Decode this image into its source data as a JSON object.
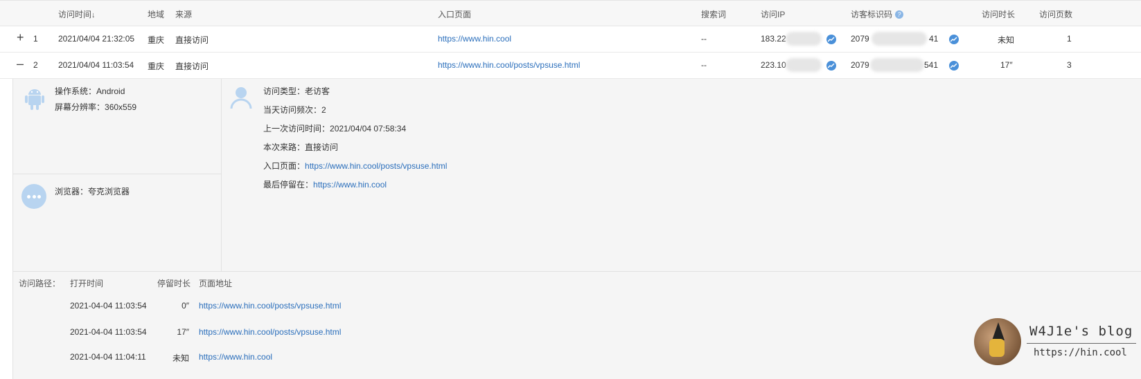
{
  "table": {
    "headers": {
      "visit_time": "访问时间",
      "sort_arrow": "↓",
      "region": "地域",
      "source": "来源",
      "entry_page": "入口页面",
      "search_term": "搜索词",
      "visit_ip": "访问IP",
      "visitor_id": "访客标识码",
      "help": "?",
      "duration": "访问时长",
      "pages": "访问页数"
    },
    "rows": [
      {
        "expander": "+",
        "index": "1",
        "time": "2021/04/04 21:32:05",
        "region": "重庆",
        "source": "直接访问",
        "entry_page": "https://www.hin.cool",
        "search_term": "--",
        "ip_prefix": "183.22",
        "visitor_prefix": "2079",
        "visitor_suffix": "41",
        "duration": "未知",
        "pages": "1"
      },
      {
        "expander": "–",
        "index": "2",
        "time": "2021/04/04 11:03:54",
        "region": "重庆",
        "source": "直接访问",
        "entry_page": "https://www.hin.cool/posts/vpsuse.html",
        "search_term": "--",
        "ip_prefix": "223.10",
        "visitor_prefix": "2079",
        "visitor_suffix": "541",
        "duration": "17″",
        "pages": "3"
      }
    ]
  },
  "detail": {
    "os_label": "操作系统：",
    "os_value": "Android",
    "resolution_label": "屏幕分辨率：",
    "resolution_value": "360x559",
    "browser_label": "浏览器：",
    "browser_value": "夸克浏览器",
    "visit_type_label": "访问类型：",
    "visit_type_value": "老访客",
    "daily_freq_label": "当天访问频次：",
    "daily_freq_value": "2",
    "last_visit_label": "上一次访问时间：",
    "last_visit_value": "2021/04/04 07:58:34",
    "referrer_label": "本次来路：",
    "referrer_value": "直接访问",
    "entry_label": "入口页面：",
    "entry_value": "https://www.hin.cool/posts/vpsuse.html",
    "last_stay_label": "最后停留在：",
    "last_stay_value": "https://www.hin.cool"
  },
  "path": {
    "title": "访问路径：",
    "col_open": "打开时间",
    "col_stay": "停留时长",
    "col_url": "页面地址",
    "rows": [
      {
        "open": "2021-04-04 11:03:54",
        "stay": "0″",
        "url": "https://www.hin.cool/posts/vpsuse.html"
      },
      {
        "open": "2021-04-04 11:03:54",
        "stay": "17″",
        "url": "https://www.hin.cool/posts/vpsuse.html"
      },
      {
        "open": "2021-04-04 11:04:11",
        "stay": "未知",
        "url": "https://www.hin.cool"
      }
    ]
  },
  "watermark": {
    "title": "W4J1e's blog",
    "url": "https://hin.cool"
  },
  "colors": {
    "link": "#2a6ebb",
    "icon_blue": "#4a90d9",
    "icon_light": "#b8d4f0"
  }
}
